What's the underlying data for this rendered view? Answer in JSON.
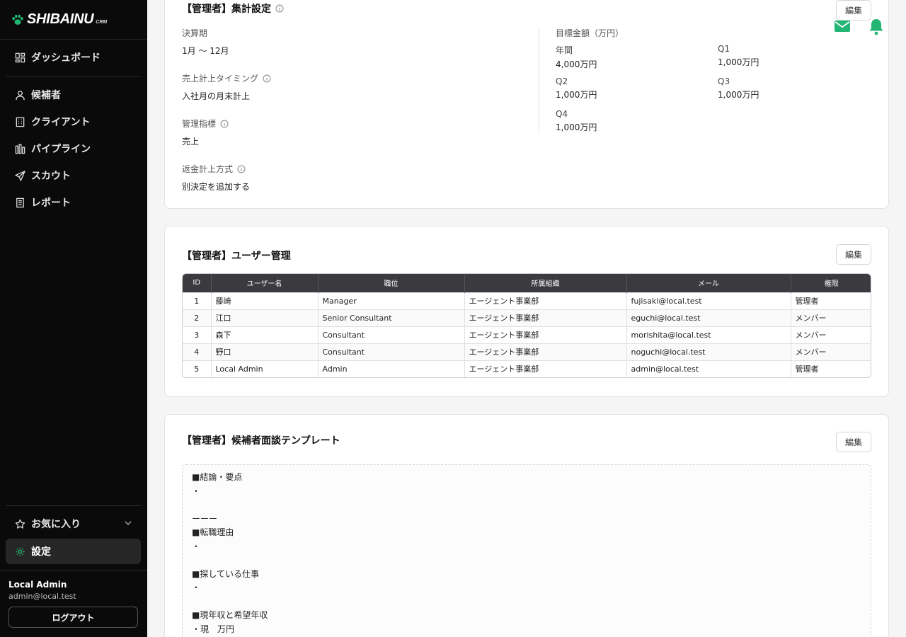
{
  "app": {
    "brand": "SHIBAINU",
    "brand_sub": "CRM"
  },
  "colors": {
    "accent": "#22b573",
    "sidebar_bg": "#0a0a0a",
    "table_header": "#3b3b3f"
  },
  "sidebar": {
    "dashboard": "ダッシュボード",
    "items": [
      {
        "label": "候補者",
        "icon": "person-icon"
      },
      {
        "label": "クライアント",
        "icon": "building-icon"
      },
      {
        "label": "パイプライン",
        "icon": "pipeline-icon"
      },
      {
        "label": "スカウト",
        "icon": "send-icon"
      },
      {
        "label": "レポート",
        "icon": "report-icon"
      }
    ],
    "favorites": "お気に入り",
    "settings": "設定",
    "user_name": "Local Admin",
    "user_email": "admin@local.test",
    "logout": "ログアウト"
  },
  "edit_label": "編集",
  "aggregation": {
    "title": "【管理者】集計設定",
    "fiscal_label": "決算期",
    "fiscal_value": "1月 〜 12月",
    "sales_timing_label": "売上計上タイミング",
    "sales_timing_value": "入社月の月末計上",
    "kpi_label": "管理指標",
    "kpi_value": "売上",
    "refund_label": "返金計上方式",
    "refund_value": "別決定を追加する",
    "target_label": "目標金額（万円）",
    "targets": [
      {
        "k": "年間",
        "v": "4,000万円"
      },
      {
        "k": "Q1",
        "v": "1,000万円"
      },
      {
        "k": "Q2",
        "v": "1,000万円"
      },
      {
        "k": "Q3",
        "v": "1,000万円"
      },
      {
        "k": "Q4",
        "v": "1,000万円"
      }
    ]
  },
  "users": {
    "title": "【管理者】ユーザー管理",
    "headers": [
      "ID",
      "ユーザー名",
      "職位",
      "所属組織",
      "メール",
      "権限"
    ],
    "rows": [
      [
        "1",
        "藤崎",
        "Manager",
        "エージェント事業部",
        "fujisaki@local.test",
        "管理者"
      ],
      [
        "2",
        "江口",
        "Senior Consultant",
        "エージェント事業部",
        "eguchi@local.test",
        "メンバー"
      ],
      [
        "3",
        "森下",
        "Consultant",
        "エージェント事業部",
        "morishita@local.test",
        "メンバー"
      ],
      [
        "4",
        "野口",
        "Consultant",
        "エージェント事業部",
        "noguchi@local.test",
        "メンバー"
      ],
      [
        "5",
        "Local Admin",
        "Admin",
        "エージェント事業部",
        "admin@local.test",
        "管理者"
      ]
    ]
  },
  "template": {
    "title": "【管理者】候補者面談テンプレート",
    "lines": [
      "■結論・要点",
      "・",
      "",
      "ーーー",
      "■転職理由",
      "・",
      "",
      "■探している仕事",
      "・",
      "",
      "■現年収と希望年収",
      "・現　万円"
    ]
  }
}
